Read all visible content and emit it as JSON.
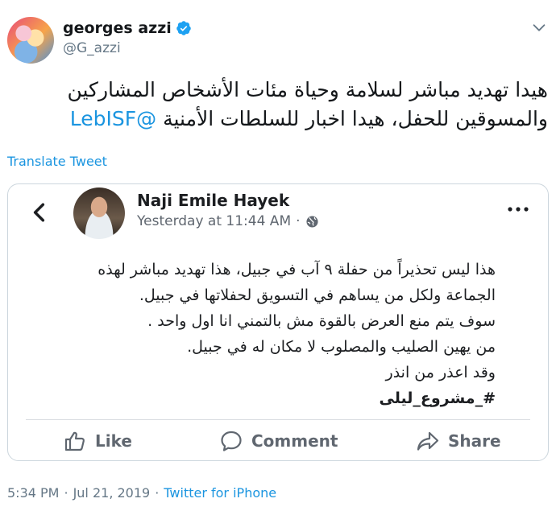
{
  "tweet": {
    "author_name": "georges azzi",
    "handle": "@G_azzi",
    "text_line1": "هيدا تهديد مباشر لسلامة وحياة مئات الأشخاص المشاركين",
    "text_line2_prefix": "والمسوقين للحفل، هيدا اخبار للسلطات الأمنية",
    "mention": "@LebISF",
    "translate_label": "Translate Tweet",
    "time": "5:34 PM",
    "separator": "·",
    "date": "Jul 21, 2019",
    "source": "Twitter for iPhone"
  },
  "embedded_post": {
    "author_name": "Naji Emile Hayek",
    "timestamp": "Yesterday at 11:44 AM",
    "separator": "·",
    "lines": [
      "هذا ليس تحذيراً من حفلة ٩ آب في جبيل، هذا تهديد مباشر لهذه",
      "الجماعة ولكل من يساهم في التسويق لحفلاتها في جبيل.",
      "سوف يتم منع العرض بالقوة مش بالتمني انا اول واحد .",
      "من يهين الصليب والمصلوب لا مكان له في جبيل.",
      "وقد اعذر من انذر"
    ],
    "hashtag": "#_مشروع_ليلى",
    "actions": {
      "like": "Like",
      "comment": "Comment",
      "share": "Share"
    }
  },
  "icons": {
    "verified": "verified-badge-icon",
    "caret": "chevron-down-icon",
    "back": "chevron-left-icon",
    "globe": "globe-icon",
    "more": "more-dots-icon",
    "like": "thumbs-up-icon",
    "comment": "comment-bubble-icon",
    "share": "share-arrow-icon"
  },
  "colors": {
    "link": "#1b95e0",
    "verified": "#1da1f2",
    "muted": "#657786",
    "fb_muted": "#606770"
  }
}
